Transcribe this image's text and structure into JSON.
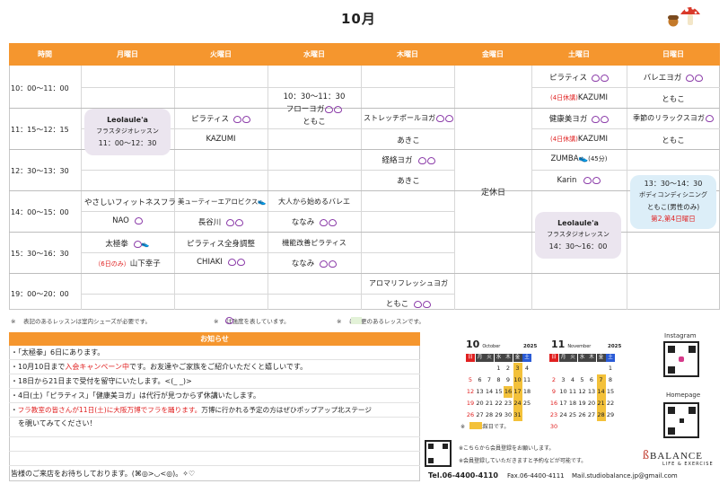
{
  "title": "10月",
  "header": {
    "days": [
      "時間",
      "月曜日",
      "火曜日",
      "水曜日",
      "木曜日",
      "金曜日",
      "土曜日",
      "日曜日"
    ]
  },
  "times": [
    "10：00～11：00",
    "11：15～12：15",
    "12：30～13：30",
    "14：00～15：00",
    "15：30～16：30",
    "19：00～20：00"
  ],
  "classes": {
    "mon_bubble1": [
      "Leolaule'a",
      "フラスタジオレッスン",
      "11：00～12：30"
    ],
    "mon_15_1": "やさしいフィットネスフラ",
    "mon_15_2": "NAO",
    "mon_16_1": "太極拳",
    "mon_16_pre": "（6日のみ）",
    "mon_16_2": "山下幸子",
    "tue_11_1": "ピラティス",
    "tue_11_2": "KAZUMI",
    "tue_14_1": "美ューティーエアロビクス",
    "tue_14_2": "長谷川",
    "tue_15_1": "ピラティス全身調整",
    "tue_15_2": "CHIAKI",
    "wed_10_time": "10：30～11：30",
    "wed_10_1": "フローヨガ",
    "wed_10_2": "ともこ",
    "wed_14_1": "大人から始めるバレエ",
    "wed_14_2": "ななみ",
    "wed_15_1": "機能改善ピラティス",
    "wed_15_2": "ななみ",
    "thu_11_1": "ストレッチポールヨガ",
    "thu_11_2": "あきこ",
    "thu_12_1": "経絡ヨガ",
    "thu_12_2": "あきこ",
    "thu_19_1": "アロマリフレッシュヨガ",
    "thu_19_2": "ともこ",
    "fri": "定休日",
    "sat_10_1": "ピラティス",
    "sat_10_pre": "(4日休講)",
    "sat_10_2": "KAZUMI",
    "sat_11_1": "健康美ヨガ",
    "sat_11_pre": "(4日休講)",
    "sat_11_2": "KAZUMI",
    "sat_12_1": "ZUMBA",
    "sat_12_tag": "(45分)",
    "sat_12_2": "Karin",
    "sat_bubble": [
      "Leolaule'a",
      "フラスタジオレッスン",
      "14：30～16：00"
    ],
    "sun_10_1": "バレエヨガ",
    "sun_10_2": "ともこ",
    "sun_11_1": "季節のリラックスヨガ",
    "sun_11_2": "ともこ",
    "sun_bubble": [
      "13：30～14：30",
      "ボディコンディシニング",
      "ともこ(男性のみ)",
      "第2,第4日曜日"
    ]
  },
  "notes": {
    "n1": "※　  表記のあるレッスンは室内シューズが必要です。",
    "n2": "※　  は強度を表しています。",
    "n3": "※　  は変更のあるレッスンです。"
  },
  "news": {
    "title": "お知らせ",
    "lines": [
      "・「太極拳」6日にあります。",
      "・10月10日まで入会キャンペーン中です。お友達やご家族をご紹介いただくと嬉しいです。",
      "・18日から21日まで受付を留守にいたします。<(_ _)>",
      "・4日(土)「ピラティス」「健康美ヨガ」は代行が見つからず休講いたします。",
      "・フラ教室の皆さんが11日(土)に大阪万博でフラを踊ります。万博に行かれる予定の方はぜひポップアップ北ステージ",
      "　を覗いてみてください！",
      "",
      "",
      "皆様のご来店をお待ちしております。(⌘◎>◡<◎)。✧♡"
    ]
  },
  "calendar_oct": {
    "month": "10",
    "label": "October",
    "year": "2025",
    "weekdays": [
      "日",
      "月",
      "火",
      "水",
      "木",
      "金",
      "土"
    ],
    "rows": [
      [
        "",
        "",
        "",
        "1",
        "2",
        "3",
        "4"
      ],
      [
        "5",
        "6",
        "7",
        "8",
        "9",
        "10",
        "11"
      ],
      [
        "12",
        "13",
        "14",
        "15",
        "16",
        "17",
        "18"
      ],
      [
        "19",
        "20",
        "21",
        "22",
        "23",
        "24",
        "25"
      ],
      [
        "26",
        "27",
        "28",
        "29",
        "30",
        "31",
        ""
      ]
    ]
  },
  "calendar_nov": {
    "month": "11",
    "label": "November",
    "year": "2025",
    "weekdays": [
      "日",
      "月",
      "火",
      "水",
      "木",
      "金",
      "土"
    ],
    "rows": [
      [
        "",
        "",
        "",
        "",
        "",
        "",
        "1"
      ],
      [
        "2",
        "3",
        "4",
        "5",
        "6",
        "7",
        "8"
      ],
      [
        "9",
        "10",
        "11",
        "12",
        "13",
        "14",
        "15"
      ],
      [
        "16",
        "17",
        "18",
        "19",
        "20",
        "21",
        "22"
      ],
      [
        "23",
        "24",
        "25",
        "26",
        "27",
        "28",
        "29"
      ],
      [
        "30",
        "",
        "",
        "",
        "",
        "",
        ""
      ]
    ]
  },
  "calendar_note": "※　  は休館日です。",
  "register_note1": "※こちらから会員登録をお願いします。",
  "register_note2": "※会員登録していただきますと予約などが可能です。",
  "footer": {
    "tel": "Tel.06-4400-4110",
    "fax": "Fax.06-4400-4111",
    "mail": "Mail.studiobalance.jp@gmail.com"
  },
  "instagram": "Instagram",
  "homepage": "Homepage",
  "brand": "BALANCE",
  "brand_sub": "LIFE & EXERCISE",
  "colors": {
    "accent": "#f5962e",
    "heart": "#8a3aa8",
    "red": "#e02020",
    "holiday": "#f3c13a",
    "sunday": "#e02020",
    "saturday": "#2a5bd6"
  }
}
